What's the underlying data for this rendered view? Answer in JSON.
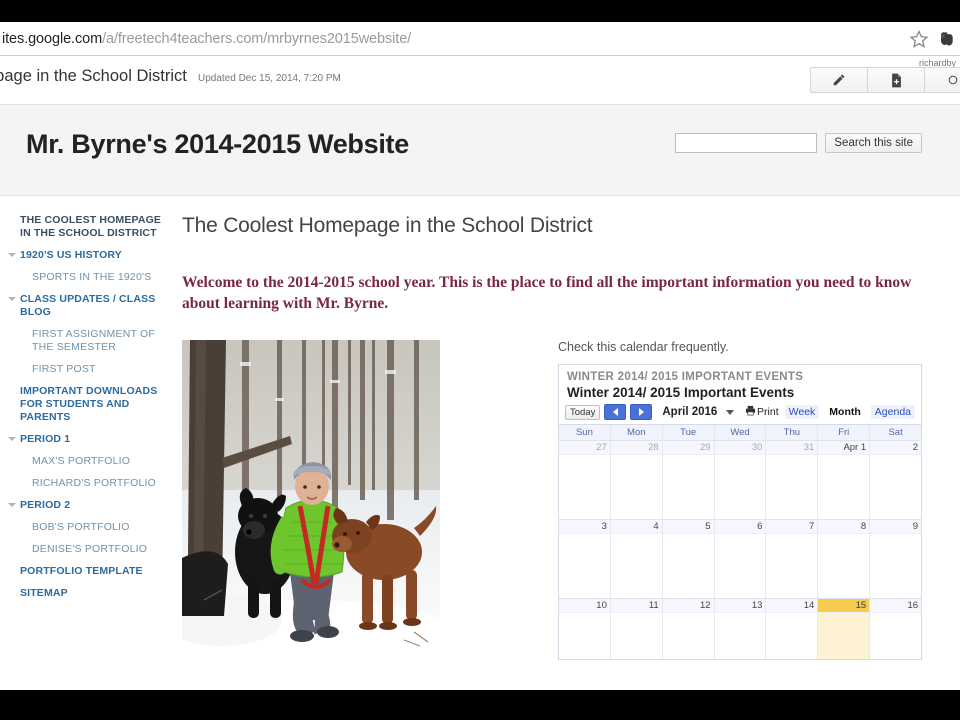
{
  "browser": {
    "url_host": "ites.google.com",
    "url_path": "/a/freetech4teachers.com/mrbyrnes2015website/",
    "star_icon": "star-icon",
    "extension_icon": "evernote-elephant-icon"
  },
  "sites_toolbar": {
    "page_crumb": "epage in the School District",
    "updated": "Updated Dec 15, 2014, 7:20 PM",
    "account": "richardby",
    "buttons": [
      {
        "name": "edit-page-button",
        "icon": "pencil-icon"
      },
      {
        "name": "new-page-button",
        "icon": "new-page-icon"
      },
      {
        "name": "more-actions-button",
        "icon": "more-icon"
      }
    ]
  },
  "site_header": {
    "title": "Mr. Byrne's 2014-2015 Website",
    "search_value": "",
    "search_placeholder": "",
    "search_button": "Search this site"
  },
  "sidebar": {
    "items": [
      {
        "label": "The Coolest Homepage in the School District",
        "level": "top",
        "caret": false
      },
      {
        "label": "1920's US History",
        "level": "link",
        "caret": true
      },
      {
        "label": "Sports in the 1920's",
        "level": "sub",
        "caret": false
      },
      {
        "label": "Class Updates / Class Blog",
        "level": "link",
        "caret": true
      },
      {
        "label": "First Assignment of the Semester",
        "level": "sub",
        "caret": false
      },
      {
        "label": "First Post",
        "level": "sub",
        "caret": false
      },
      {
        "label": "Important Downloads for Students and Parents",
        "level": "link",
        "caret": false
      },
      {
        "label": "Period 1",
        "level": "link",
        "caret": true
      },
      {
        "label": "Max's Portfolio",
        "level": "sub",
        "caret": false
      },
      {
        "label": "Richard's Portfolio",
        "level": "sub",
        "caret": false
      },
      {
        "label": "Period 2",
        "level": "link",
        "caret": true
      },
      {
        "label": "Bob's Portfolio",
        "level": "sub",
        "caret": false
      },
      {
        "label": "Denise's Portfolio",
        "level": "sub",
        "caret": false
      },
      {
        "label": "Portfolio Template",
        "level": "link",
        "caret": false
      },
      {
        "label": "Sitemap",
        "level": "link",
        "caret": false
      }
    ]
  },
  "content": {
    "heading": "The Coolest Homepage in the School District",
    "welcome": "Welcome to the 2014-2015 school year. This is the place to find all the important information you need to know about learning with Mr. Byrne.",
    "photo_alt": "Man in green jacket kneeling in snowy woods with a black dog and a brown dog",
    "calendar_note": "Check this calendar frequently."
  },
  "calendar": {
    "gadget_title": "WINTER 2014/ 2015 IMPORTANT EVENTS",
    "calendar_name": "Winter 2014/ 2015 Important Events",
    "today_label": "Today",
    "prev_label": "Previous period",
    "next_label": "Next period",
    "month_label": "April 2016",
    "print_label": "Print",
    "views": [
      {
        "label": "Week",
        "active": false
      },
      {
        "label": "Month",
        "active": true
      },
      {
        "label": "Agenda",
        "active": false
      }
    ],
    "day_headers": [
      "Sun",
      "Mon",
      "Tue",
      "Wed",
      "Thu",
      "Fri",
      "Sat"
    ],
    "weeks": [
      [
        {
          "num": "27",
          "other": true,
          "today": false
        },
        {
          "num": "28",
          "other": true,
          "today": false
        },
        {
          "num": "29",
          "other": true,
          "today": false
        },
        {
          "num": "30",
          "other": true,
          "today": false
        },
        {
          "num": "31",
          "other": true,
          "today": false
        },
        {
          "num": "Apr 1",
          "other": false,
          "today": false
        },
        {
          "num": "2",
          "other": false,
          "today": false
        }
      ],
      [
        {
          "num": "3",
          "other": false,
          "today": false
        },
        {
          "num": "4",
          "other": false,
          "today": false
        },
        {
          "num": "5",
          "other": false,
          "today": false
        },
        {
          "num": "6",
          "other": false,
          "today": false
        },
        {
          "num": "7",
          "other": false,
          "today": false
        },
        {
          "num": "8",
          "other": false,
          "today": false
        },
        {
          "num": "9",
          "other": false,
          "today": false
        }
      ],
      [
        {
          "num": "10",
          "other": false,
          "today": false
        },
        {
          "num": "11",
          "other": false,
          "today": false
        },
        {
          "num": "12",
          "other": false,
          "today": false
        },
        {
          "num": "13",
          "other": false,
          "today": false
        },
        {
          "num": "14",
          "other": false,
          "today": false
        },
        {
          "num": "15",
          "other": false,
          "today": true
        },
        {
          "num": "16",
          "other": false,
          "today": false
        }
      ]
    ]
  },
  "colors": {
    "nav_link": "#2c6b9e",
    "nav_sub": "#6e92ad",
    "welcome_text": "#7a2741",
    "today_highlight": "#f7cb4d",
    "calendar_blue": "#4a71d6"
  }
}
